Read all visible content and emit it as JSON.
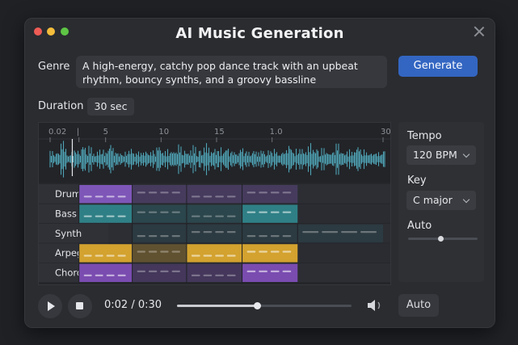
{
  "window": {
    "title": "AI Music Generation"
  },
  "prompt": {
    "label": "Genre",
    "value": "A high-energy, catchy pop dance track with an upbeat rhythm, bouncy synths, and a groovy bassline"
  },
  "generate_button": "Generate",
  "duration": {
    "label": "Duration",
    "value": "30 sec"
  },
  "timeline": {
    "ticks": [
      {
        "text": "0.02",
        "t": 0
      },
      {
        "text": "|",
        "t": 2.6
      },
      {
        "text": "5",
        "t": 5
      },
      {
        "text": "10",
        "t": 10
      },
      {
        "text": "15",
        "t": 15
      },
      {
        "text": "1.0",
        "t": 20
      },
      {
        "text": "30",
        "t": 30
      }
    ],
    "max": 30,
    "playhead": 2.0
  },
  "tracks": [
    {
      "name": "Drums",
      "color": "#7e56b8",
      "clips": [
        [
          2.6,
          7.4
        ],
        [
          7.4,
          12.3
        ],
        [
          12.3,
          17.3
        ],
        [
          17.3,
          22.3
        ]
      ],
      "bright": [
        0
      ]
    },
    {
      "name": "Bass",
      "color": "#2f8086",
      "clips": [
        [
          2.6,
          7.4
        ],
        [
          7.4,
          12.3
        ],
        [
          12.3,
          17.3
        ],
        [
          17.3,
          22.3
        ]
      ],
      "bright": [
        0,
        3
      ]
    },
    {
      "name": "Synth",
      "color": "#2e5560",
      "clips": [
        [
          7.4,
          12.3
        ],
        [
          12.3,
          17.3
        ],
        [
          17.3,
          22.3
        ],
        [
          22.3,
          30
        ]
      ],
      "bright": []
    },
    {
      "name": "Arpeggio",
      "color": "#d3a22f",
      "clips": [
        [
          2.6,
          7.4
        ],
        [
          7.4,
          12.3
        ],
        [
          12.3,
          17.3
        ],
        [
          17.3,
          22.3
        ]
      ],
      "bright": [
        0,
        2,
        3
      ]
    },
    {
      "name": "Chords",
      "color": "#7a4cb0",
      "clips": [
        [
          2.6,
          7.4
        ],
        [
          7.4,
          12.3
        ],
        [
          12.3,
          17.3
        ],
        [
          17.3,
          22.3
        ]
      ],
      "bright": [
        0,
        3
      ]
    }
  ],
  "settings": {
    "tempo": {
      "label": "Tempo",
      "value": "120 BPM"
    },
    "key": {
      "label": "Key",
      "value": "C major"
    },
    "auto": {
      "label": "Auto",
      "level": 0.46
    }
  },
  "transport": {
    "time": "0:02 / 0:30",
    "progress": 0.46,
    "auto_label": "Auto"
  },
  "colors": {
    "waveform": "#4fa3b5",
    "accent": "#3366c2"
  }
}
